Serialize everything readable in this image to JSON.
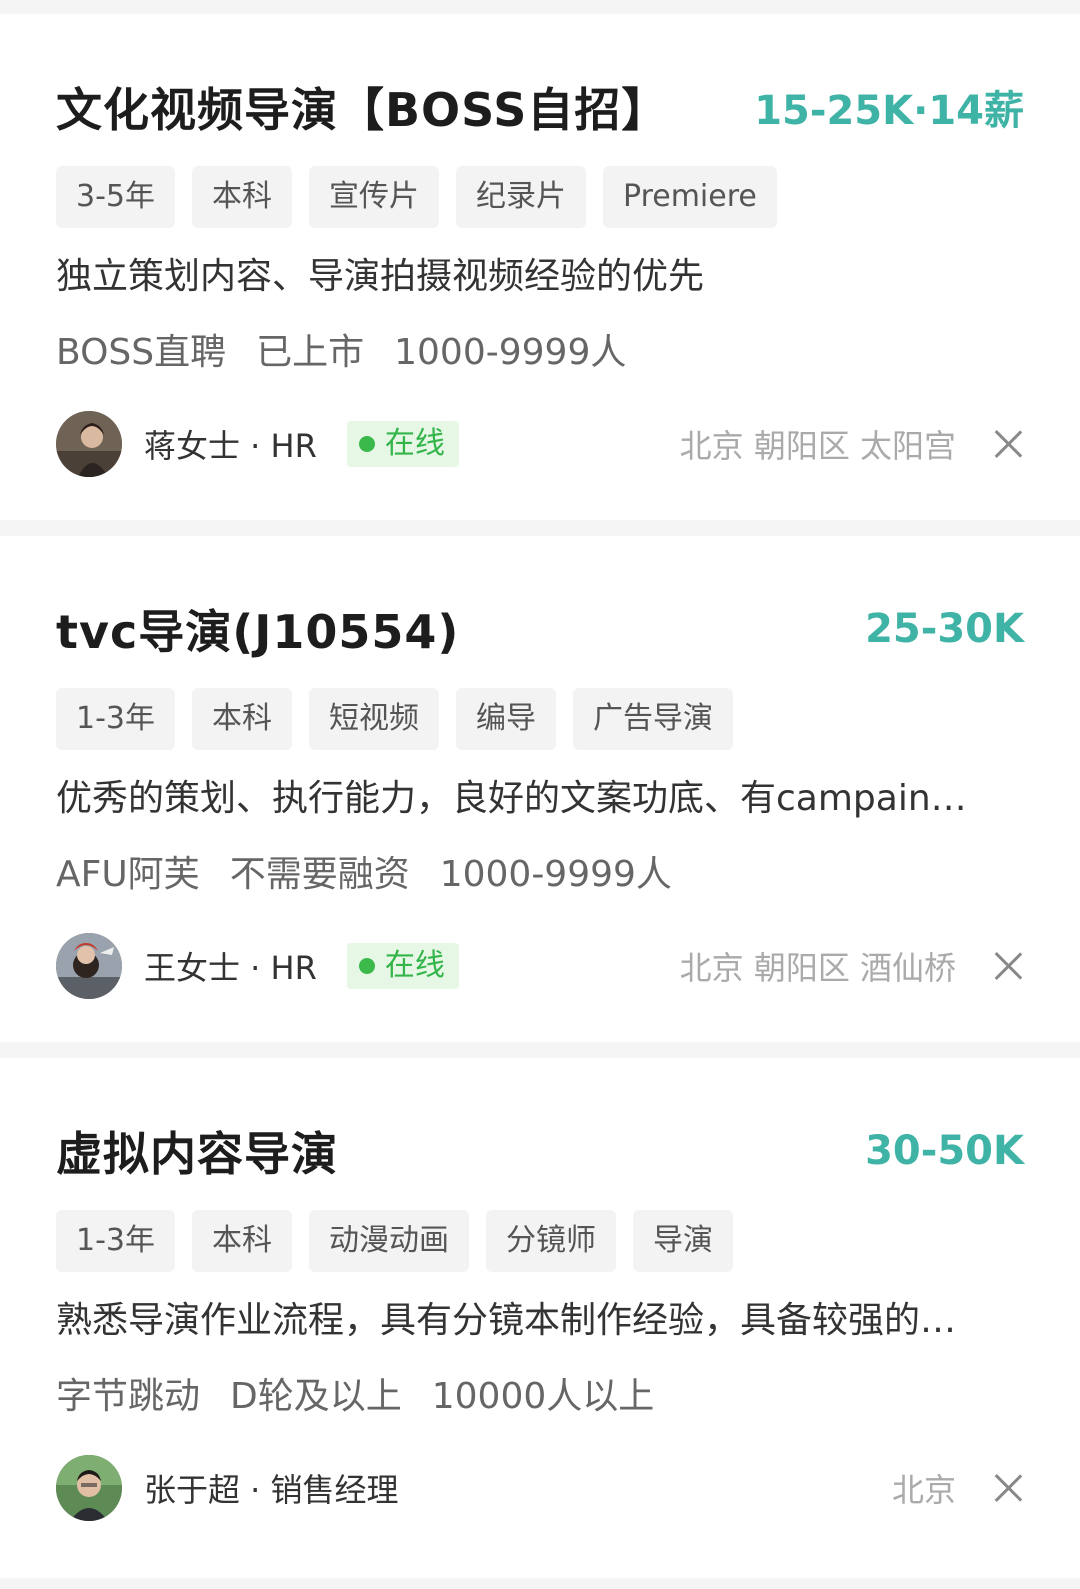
{
  "jobs": [
    {
      "title": "文化视频导演【BOSS自招】",
      "salary": "15-25K·14薪",
      "tags": [
        "3-5年",
        "本科",
        "宣传片",
        "纪录片",
        "Premiere"
      ],
      "description": "独立策划内容、导演拍摄视频经验的优先",
      "company": [
        "BOSS直聘",
        "已上市",
        "1000-9999人"
      ],
      "recruiter": "蒋女士 · HR",
      "online": "在线",
      "location": "北京 朝阳区 太阳宫"
    },
    {
      "title": "tvc导演(J10554)",
      "salary": "25-30K",
      "tags": [
        "1-3年",
        "本科",
        "短视频",
        "编导",
        "广告导演"
      ],
      "description": "优秀的策划、执行能力，良好的文案功底、有campain…",
      "company": [
        "AFU阿芙",
        "不需要融资",
        "1000-9999人"
      ],
      "recruiter": "王女士 · HR",
      "online": "在线",
      "location": "北京 朝阳区 酒仙桥"
    },
    {
      "title": "虚拟内容导演",
      "salary": "30-50K",
      "tags": [
        "1-3年",
        "本科",
        "动漫动画",
        "分镜师",
        "导演"
      ],
      "description": "熟悉导演作业流程，具有分镜本制作经验，具备较强的…",
      "company": [
        "字节跳动",
        "D轮及以上",
        "10000人以上"
      ],
      "recruiter": "张于超 · 销售经理",
      "location": "北京"
    }
  ],
  "colors": {
    "salary": "#3fb3a6",
    "online_text": "#33b54a",
    "online_bg": "#e6f7e6"
  }
}
